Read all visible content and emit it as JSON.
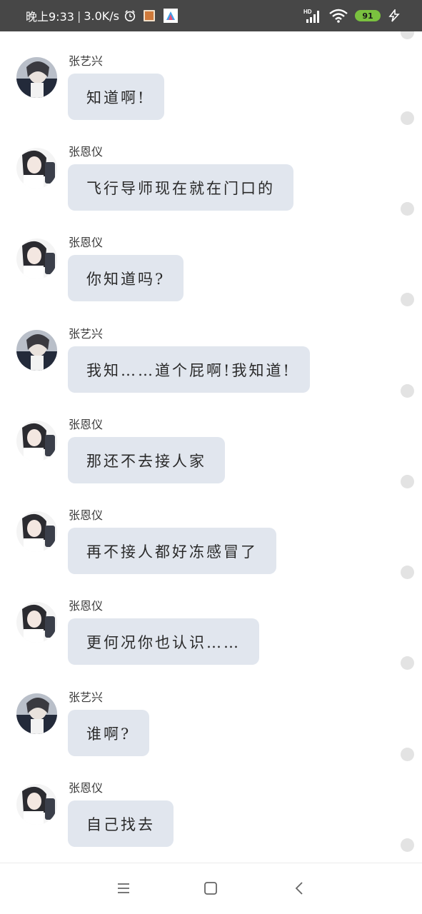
{
  "status_bar": {
    "time": "晚上9:33",
    "net_speed": "3.0K/s",
    "network_badge": "HD",
    "battery": "91",
    "icons": [
      "alarm-clock-icon",
      "notification-app-icon",
      "app-icon",
      "signal-icon",
      "wifi-icon",
      "battery-icon",
      "charging-icon"
    ]
  },
  "colors": {
    "status_bg": "#474747",
    "bubble_bg": "#e1e6ee",
    "battery_green": "#7ac13f"
  },
  "messages": [
    {
      "sender": "张艺兴",
      "text": "知道啊!"
    },
    {
      "sender": "张恩仪",
      "text": "飞行导师现在就在门口的"
    },
    {
      "sender": "张恩仪",
      "text": "你知道吗?"
    },
    {
      "sender": "张艺兴",
      "text": "我知……道个屁啊!我知道!"
    },
    {
      "sender": "张恩仪",
      "text": "那还不去接人家"
    },
    {
      "sender": "张恩仪",
      "text": "再不接人都好冻感冒了"
    },
    {
      "sender": "张恩仪",
      "text": "更何况你也认识……"
    },
    {
      "sender": "张艺兴",
      "text": "谁啊?"
    },
    {
      "sender": "张恩仪",
      "text": "自己找去"
    }
  ],
  "nav_bar": {
    "icons": [
      "menu-icon",
      "home-icon",
      "back-icon"
    ]
  }
}
